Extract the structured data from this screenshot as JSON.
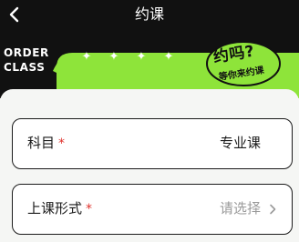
{
  "header": {
    "title": "约课"
  },
  "banner": {
    "order_line1": "ORDER",
    "order_line2": "CLASS",
    "badge_main": "约吗?",
    "badge_sub": "等你来约课",
    "accent_color": "#8ee43a"
  },
  "form": {
    "rows": [
      {
        "label": "科目",
        "required_mark": "*",
        "value": "专业课"
      },
      {
        "label": "上课形式",
        "required_mark": "*",
        "placeholder": "请选择"
      }
    ]
  }
}
